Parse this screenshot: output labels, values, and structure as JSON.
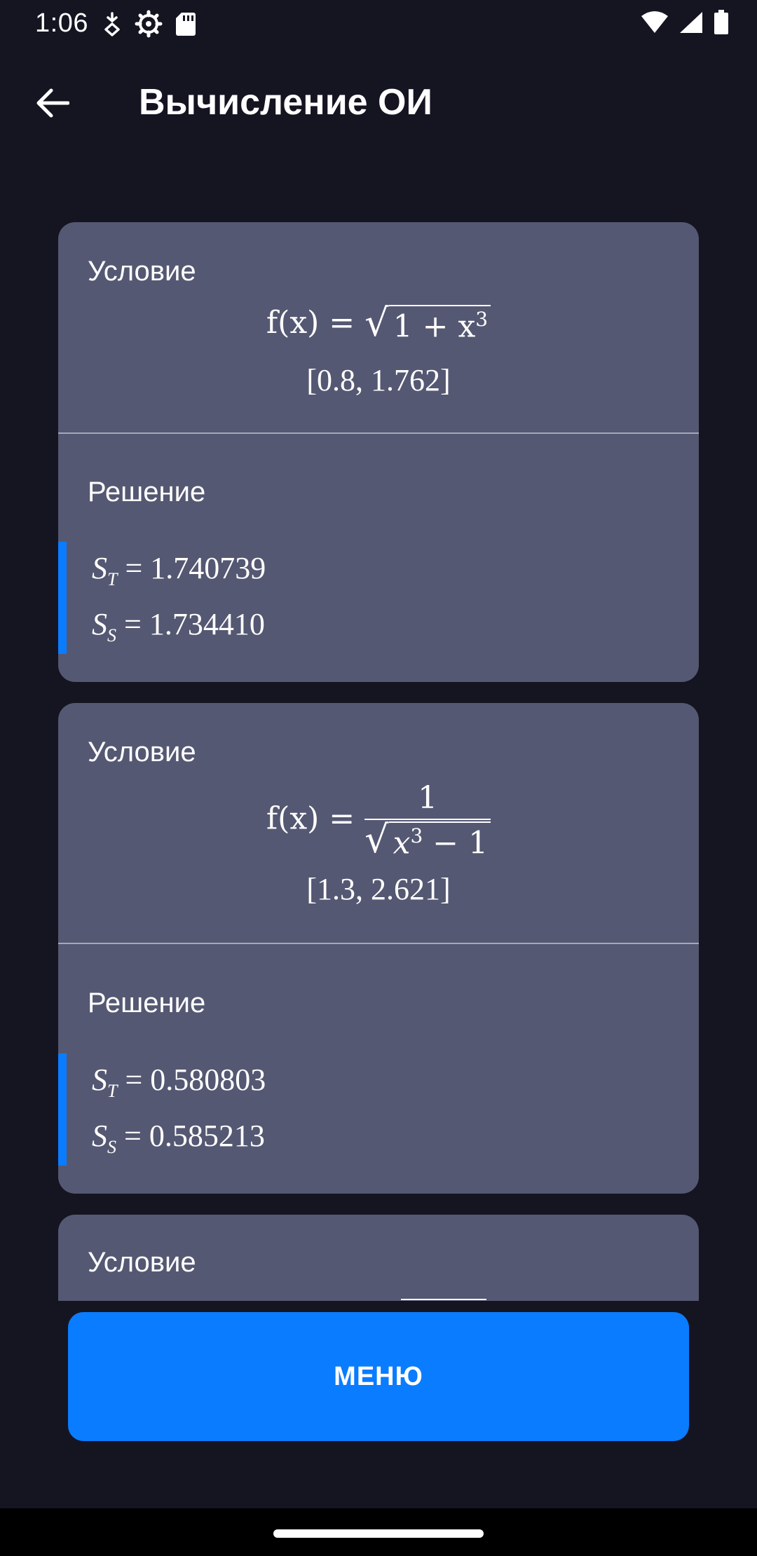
{
  "status_bar": {
    "time": "1:06",
    "left_icons": [
      "data-saver-icon",
      "settings-gear-icon",
      "sd-card-icon"
    ],
    "right_icons": [
      "wifi-icon",
      "cell-signal-icon",
      "battery-icon"
    ]
  },
  "app_bar": {
    "title": "Вычисление ОИ",
    "back_icon": "arrow-back-icon"
  },
  "colors": {
    "background": "#141521",
    "card": "#555872",
    "accent": "#0a7cff",
    "divider": "#a6a8b8"
  },
  "cards": [
    {
      "condition_label": "Условие",
      "function_lhs": "f(x) =",
      "function_radicand_base": "1 + x",
      "function_exponent": "3",
      "interval": "[0.8, 1.762]",
      "solution_label": "Решение",
      "st_symbol": "S",
      "st_sub": "T",
      "st_value": "= 1.740739",
      "ss_symbol": "S",
      "ss_sub": "S",
      "ss_value": "= 1.734410"
    },
    {
      "condition_label": "Условие",
      "function_lhs": "f(x) =",
      "function_numerator": "1",
      "function_radicand_base": "x",
      "function_exponent": "3",
      "function_radicand_tail": " − 1",
      "interval": "[1.3, 2.621]",
      "solution_label": "Решение",
      "st_symbol": "S",
      "st_sub": "T",
      "st_value": "= 0.580803",
      "ss_symbol": "S",
      "ss_sub": "S",
      "ss_value": "= 0.585213"
    },
    {
      "condition_label": "Условие"
    }
  ],
  "menu_button_label": "МЕНЮ"
}
